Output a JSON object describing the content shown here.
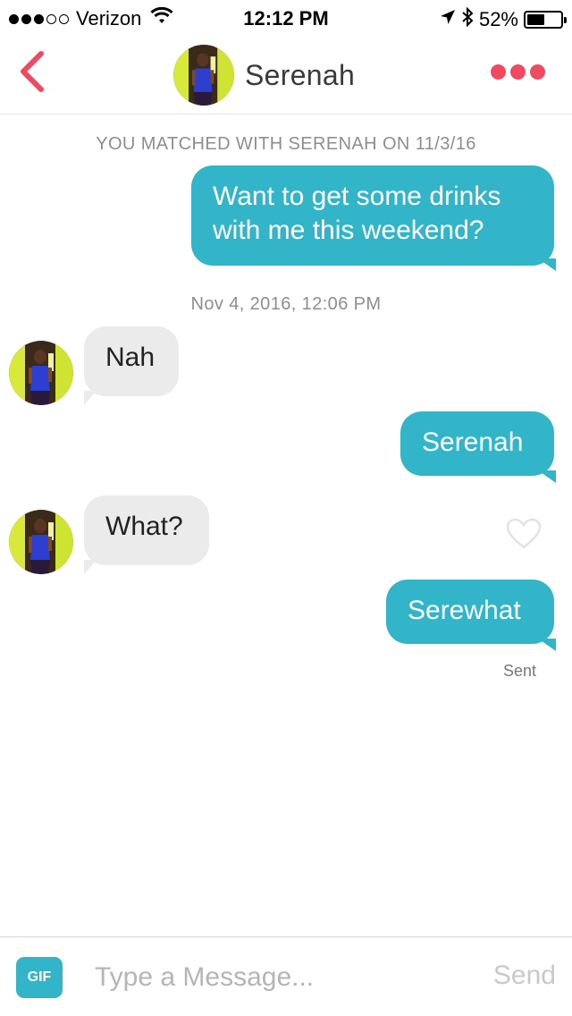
{
  "status_bar": {
    "carrier": "Verizon",
    "time": "12:12 PM",
    "battery": "52%",
    "battery_level": 0.52,
    "signal_bars": 3,
    "icons": [
      "wifi-icon",
      "location-arrow-icon",
      "bluetooth-icon",
      "battery-icon"
    ]
  },
  "header": {
    "name": "Serenah",
    "icons": [
      "back-chevron-icon",
      "more-dots-icon"
    ]
  },
  "chat": {
    "match_notice": "YOU MATCHED WITH SERENAH ON 11/3/16",
    "timestamp": "Nov 4, 2016, 12:06 PM",
    "messages": [
      {
        "direction": "outgoing",
        "text_line1": "Want to get some drinks",
        "text_line2": "with me this weekend?"
      },
      {
        "direction": "incoming",
        "text": "Nah"
      },
      {
        "direction": "outgoing",
        "text": "Serenah"
      },
      {
        "direction": "incoming",
        "text": "What?",
        "like_icon": "heart-outline-icon"
      },
      {
        "direction": "outgoing",
        "text": "Serewhat",
        "status": "Sent"
      }
    ]
  },
  "input_bar": {
    "gif_label": "GIF",
    "placeholder": "Type a Message...",
    "send_label": "Send"
  },
  "colors": {
    "accent_teal": "#33b5c9",
    "accent_red": "#ef4a5f",
    "incoming_bubble": "#ebebeb"
  }
}
